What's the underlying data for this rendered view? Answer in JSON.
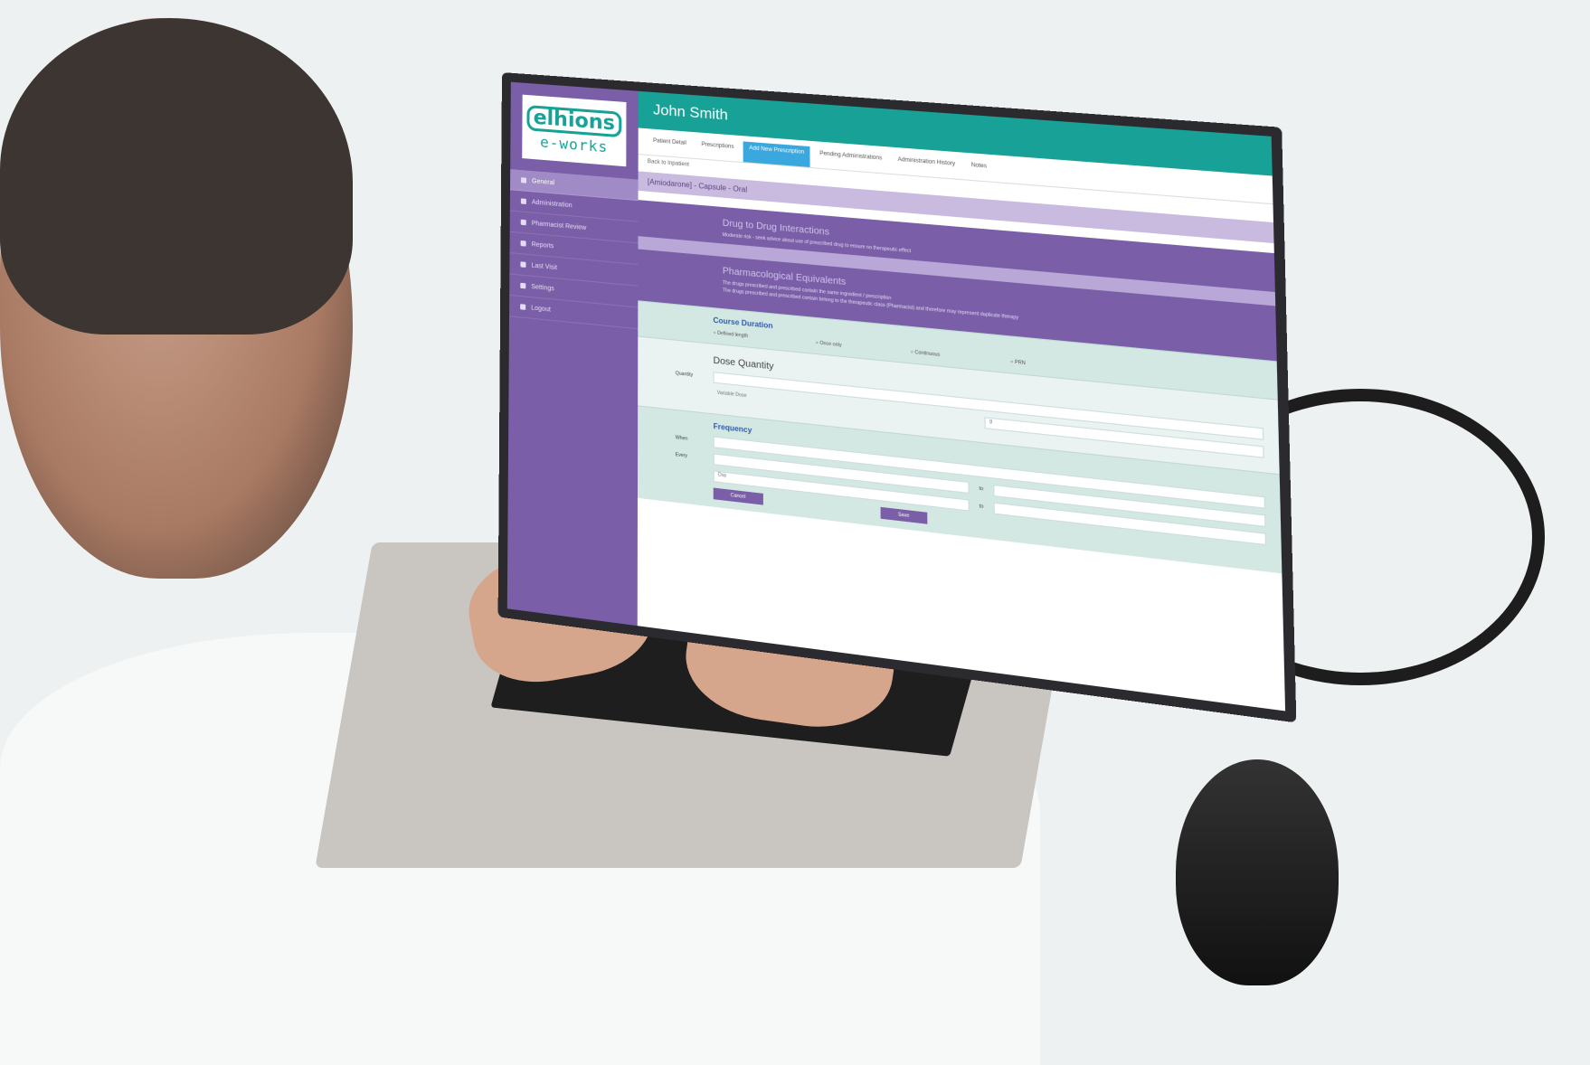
{
  "app": {
    "logo_line1": "elhions",
    "logo_line2": "e-works",
    "patient_name": "John Smith"
  },
  "sidebar": {
    "items": [
      {
        "label": "General",
        "active": true
      },
      {
        "label": "Administration",
        "active": false
      },
      {
        "label": "Pharmacist Review",
        "active": false
      },
      {
        "label": "Reports",
        "active": false
      },
      {
        "label": "Last Visit",
        "active": false
      },
      {
        "label": "Settings",
        "active": false
      },
      {
        "label": "Logout",
        "active": false
      }
    ]
  },
  "tabs": [
    {
      "label": "Patient Detail",
      "active": false
    },
    {
      "label": "Prescriptions",
      "active": false
    },
    {
      "label": "Add New Prescription",
      "active": true
    },
    {
      "label": "Pending Administrations",
      "active": false
    },
    {
      "label": "Administration History",
      "active": false
    },
    {
      "label": "Notes",
      "active": false
    }
  ],
  "subtab": "Back to Inpatient",
  "breadcrumb": "[Amiodarone] - Capsule - Oral",
  "warnings": {
    "drug_interactions_title": "Drug to Drug Interactions",
    "drug_interactions_text": "Moderate risk - seek advice about use of prescribed drug to ensure no therapeutic effect",
    "pharmacological_title": "Pharmacological Equivalents",
    "pharmacological_text1": "The drugs prescribed and prescribed contain the same ingredient / prescription",
    "pharmacological_text2": "The drugs prescribed and prescribed contain belong to the therapeutic class (Pharmacist) and therefore may represent duplicate therapy"
  },
  "course_duration": {
    "title": "Course Duration",
    "options": [
      "Defined length",
      "Once only",
      "Continuous",
      "PRN"
    ]
  },
  "dose_quantity": {
    "title": "Dose Quantity",
    "quantity_label": "Quantity",
    "variable_dose_label": "Variable Dose",
    "unit_value": "g"
  },
  "frequency": {
    "title": "Frequency",
    "when_label": "When",
    "every_label": "Every",
    "to_label": "to",
    "day_placeholder": "Day"
  },
  "buttons": {
    "save": "Save",
    "cancel": "Cancel"
  }
}
